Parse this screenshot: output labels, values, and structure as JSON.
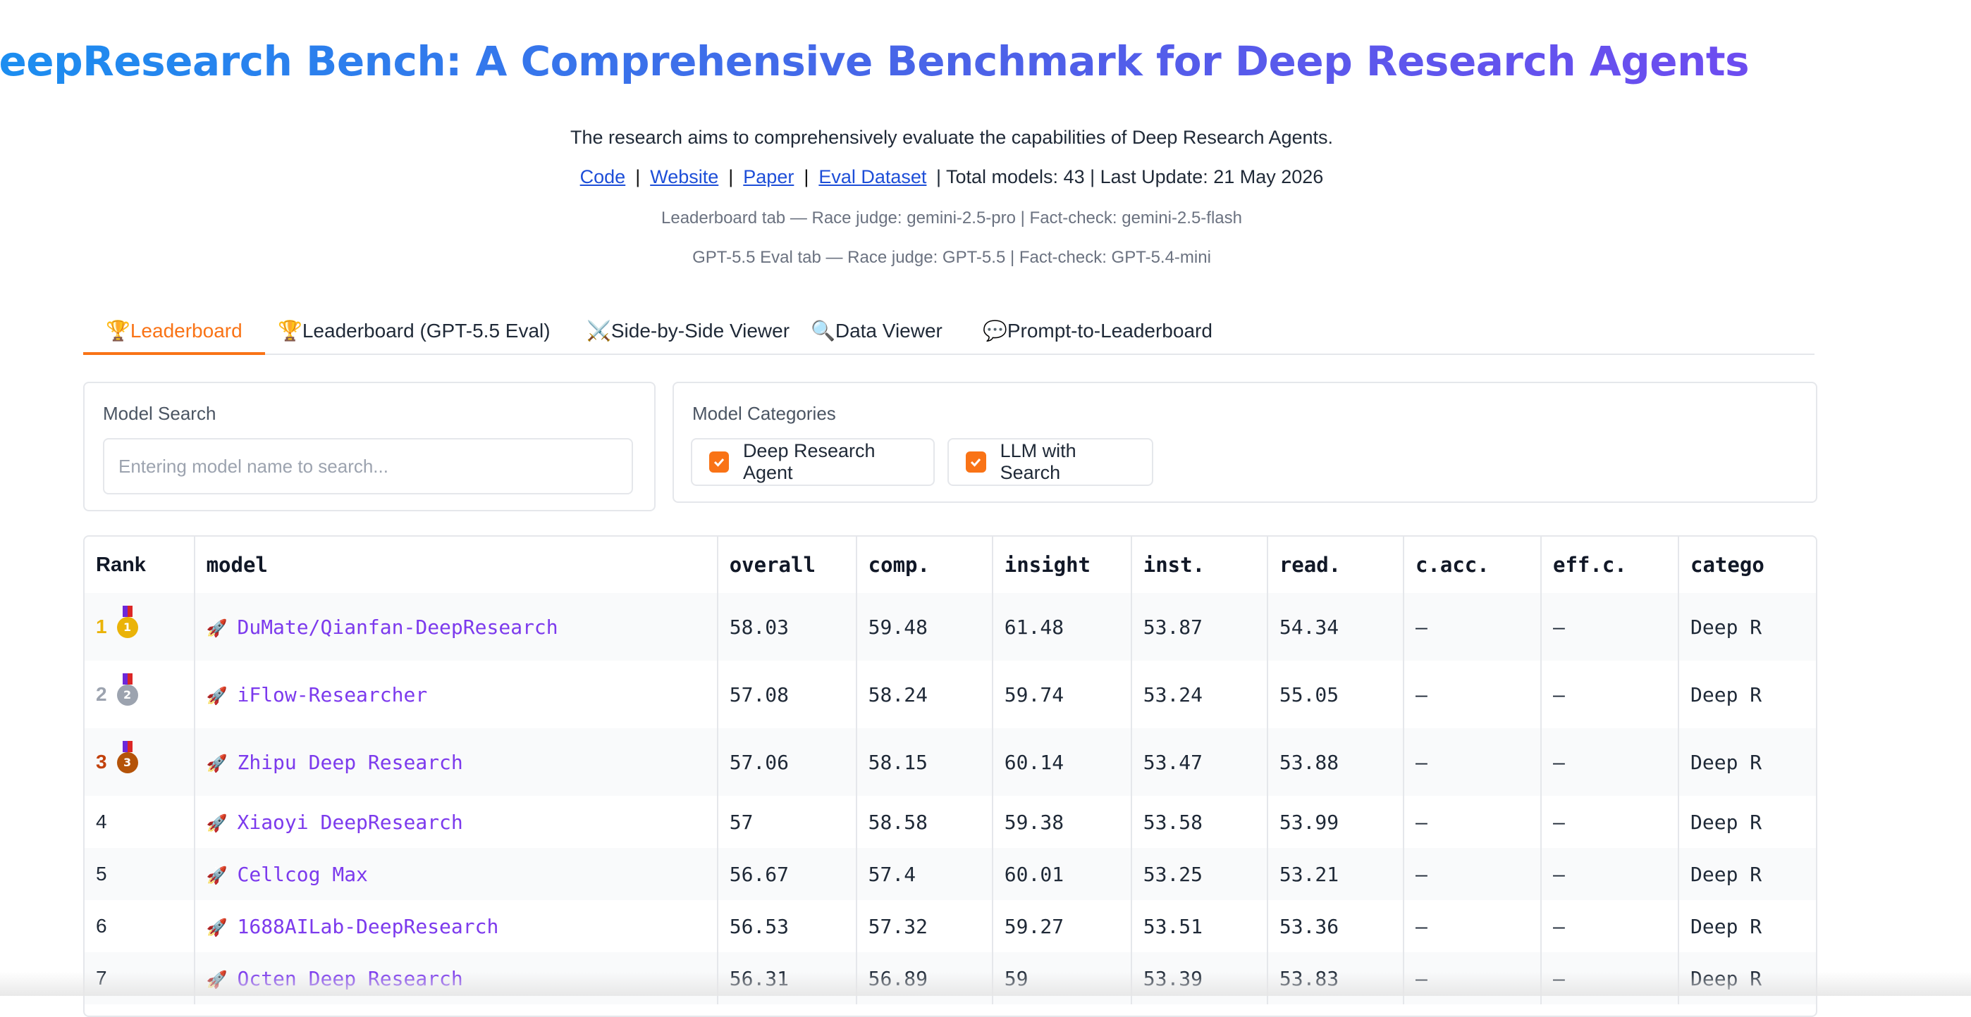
{
  "page": {
    "title": "DeepResearch Bench: A Comprehensive Benchmark for Deep Research Agents",
    "description": "The research aims to comprehensively evaluate the capabilities of Deep Research Agents.",
    "links": {
      "code": "Code",
      "website": "Website",
      "paper": "Paper",
      "eval_dataset": "Eval Dataset",
      "separator": "|",
      "meta": "| Total models: 43 | Last Update: 21 May 2026"
    },
    "judge_note_1": "Leaderboard tab — Race judge: gemini-2.5-pro | Fact-check: gemini-2.5-flash",
    "judge_note_2": "GPT-5.5 Eval tab — Race judge: GPT-5.5 | Fact-check: GPT-5.4-mini"
  },
  "tabs": [
    {
      "label": "🏆Leaderboard",
      "active": true
    },
    {
      "label": "🏆Leaderboard (GPT-5.5 Eval)",
      "active": false
    },
    {
      "label": "⚔️Side-by-Side Viewer",
      "active": false
    },
    {
      "label": "🔍Data Viewer",
      "active": false
    },
    {
      "label": "💬Prompt-to-Leaderboard",
      "active": false
    }
  ],
  "search": {
    "label": "Model Search",
    "placeholder": "Entering model name to search...",
    "value": ""
  },
  "categories": {
    "label": "Model Categories",
    "options": [
      {
        "label": "Deep Research Agent",
        "checked": true
      },
      {
        "label": "LLM with Search",
        "checked": true
      }
    ]
  },
  "table": {
    "columns": [
      "Rank",
      "model",
      "overall",
      "comp.",
      "insight",
      "inst.",
      "read.",
      "c.acc.",
      "eff.c.",
      "catego"
    ],
    "rows": [
      {
        "rank": "1",
        "medal": "gold",
        "model": "DuMate/Qianfan-DeepResearch",
        "overall": "58.03",
        "comp": "59.48",
        "insight": "61.48",
        "inst": "53.87",
        "read": "54.34",
        "cacc": "–",
        "effc": "–",
        "category": "Deep R"
      },
      {
        "rank": "2",
        "medal": "silver",
        "model": "iFlow-Researcher",
        "overall": "57.08",
        "comp": "58.24",
        "insight": "59.74",
        "inst": "53.24",
        "read": "55.05",
        "cacc": "–",
        "effc": "–",
        "category": "Deep R"
      },
      {
        "rank": "3",
        "medal": "bronze",
        "model": "Zhipu Deep Research",
        "overall": "57.06",
        "comp": "58.15",
        "insight": "60.14",
        "inst": "53.47",
        "read": "53.88",
        "cacc": "–",
        "effc": "–",
        "category": "Deep R"
      },
      {
        "rank": "4",
        "medal": "",
        "model": "Xiaoyi DeepResearch",
        "overall": "57",
        "comp": "58.58",
        "insight": "59.38",
        "inst": "53.58",
        "read": "53.99",
        "cacc": "–",
        "effc": "–",
        "category": "Deep R"
      },
      {
        "rank": "5",
        "medal": "",
        "model": "Cellcog Max",
        "overall": "56.67",
        "comp": "57.4",
        "insight": "60.01",
        "inst": "53.25",
        "read": "53.21",
        "cacc": "–",
        "effc": "–",
        "category": "Deep R"
      },
      {
        "rank": "6",
        "medal": "",
        "model": "1688AILab-DeepResearch",
        "overall": "56.53",
        "comp": "57.32",
        "insight": "59.27",
        "inst": "53.51",
        "read": "53.36",
        "cacc": "–",
        "effc": "–",
        "category": "Deep R"
      },
      {
        "rank": "7",
        "medal": "",
        "model": "Octen Deep Research",
        "overall": "56.31",
        "comp": "56.89",
        "insight": "59",
        "inst": "53.39",
        "read": "53.83",
        "cacc": "–",
        "effc": "–",
        "category": "Deep R"
      }
    ]
  },
  "colors": {
    "accent": "#f97316",
    "link": "#1d4ed8",
    "model_link": "#7c3aed",
    "gold": "#eab308",
    "silver": "#9ca3af",
    "bronze": "#b45309"
  }
}
